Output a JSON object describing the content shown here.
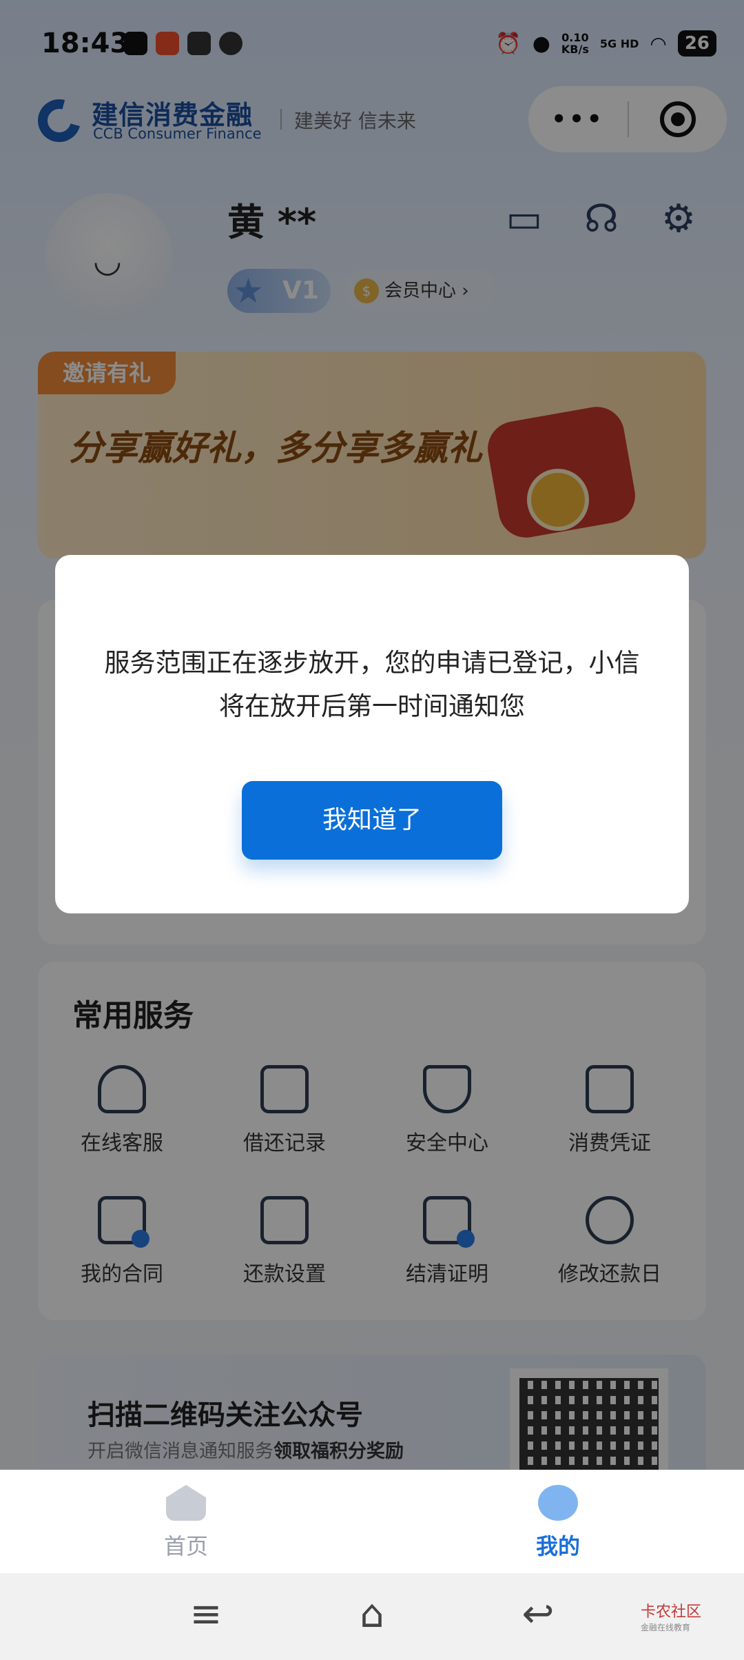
{
  "status_bar": {
    "time": "18:43",
    "net_speed_value": "0.10",
    "net_speed_unit": "KB/s",
    "network": "5G HD",
    "battery": "26",
    "icons": [
      "alarm-icon",
      "location-icon",
      "signal-icon",
      "wifi-icon"
    ]
  },
  "header": {
    "brand_cn": "建信消费金融",
    "brand_en": "CCB Consumer Finance",
    "slogan": "建美好 信未来"
  },
  "capsule": {
    "more_label": "•••",
    "close_icon": "target-icon"
  },
  "profile": {
    "name": "黄 **",
    "level": "V1",
    "member_center": "会员中心",
    "member_coin": "$",
    "icons": [
      "message-icon",
      "headset-icon",
      "gear-icon"
    ]
  },
  "invite": {
    "tag": "邀请有礼",
    "title": "分享赢好礼，多分享多赢礼"
  },
  "services": {
    "title": "常用服务",
    "items": [
      {
        "label": "在线客服",
        "icon": "headset-icon"
      },
      {
        "label": "借还记录",
        "icon": "document-icon"
      },
      {
        "label": "安全中心",
        "icon": "shield-icon"
      },
      {
        "label": "消费凭证",
        "icon": "voucher-icon"
      },
      {
        "label": "我的合同",
        "icon": "contract-icon"
      },
      {
        "label": "还款设置",
        "icon": "wallet-icon"
      },
      {
        "label": "结清证明",
        "icon": "certificate-icon"
      },
      {
        "label": "修改还款日",
        "icon": "grid-icon"
      }
    ]
  },
  "qr_card": {
    "title": "扫描二维码关注公众号",
    "subtitle_prefix": "开启微信消息通知服务",
    "subtitle_bold": "领取福积分奖励"
  },
  "modal": {
    "message": "服务范围正在逐步放开，您的申请已登记，小信将在放开后第一时间通知您",
    "button_label": "我知道了"
  },
  "tab_bar": {
    "tabs": [
      {
        "label": "首页",
        "active": false
      },
      {
        "label": "我的",
        "active": true
      }
    ],
    "active_color": "#1a6fd8",
    "inactive_color": "#9aa0aa"
  },
  "system_nav": {
    "menu_glyph": "≡",
    "home_glyph": "⌂",
    "back_glyph": "↩",
    "watermark": "卡农社区",
    "watermark_sub": "金融在线教育"
  }
}
